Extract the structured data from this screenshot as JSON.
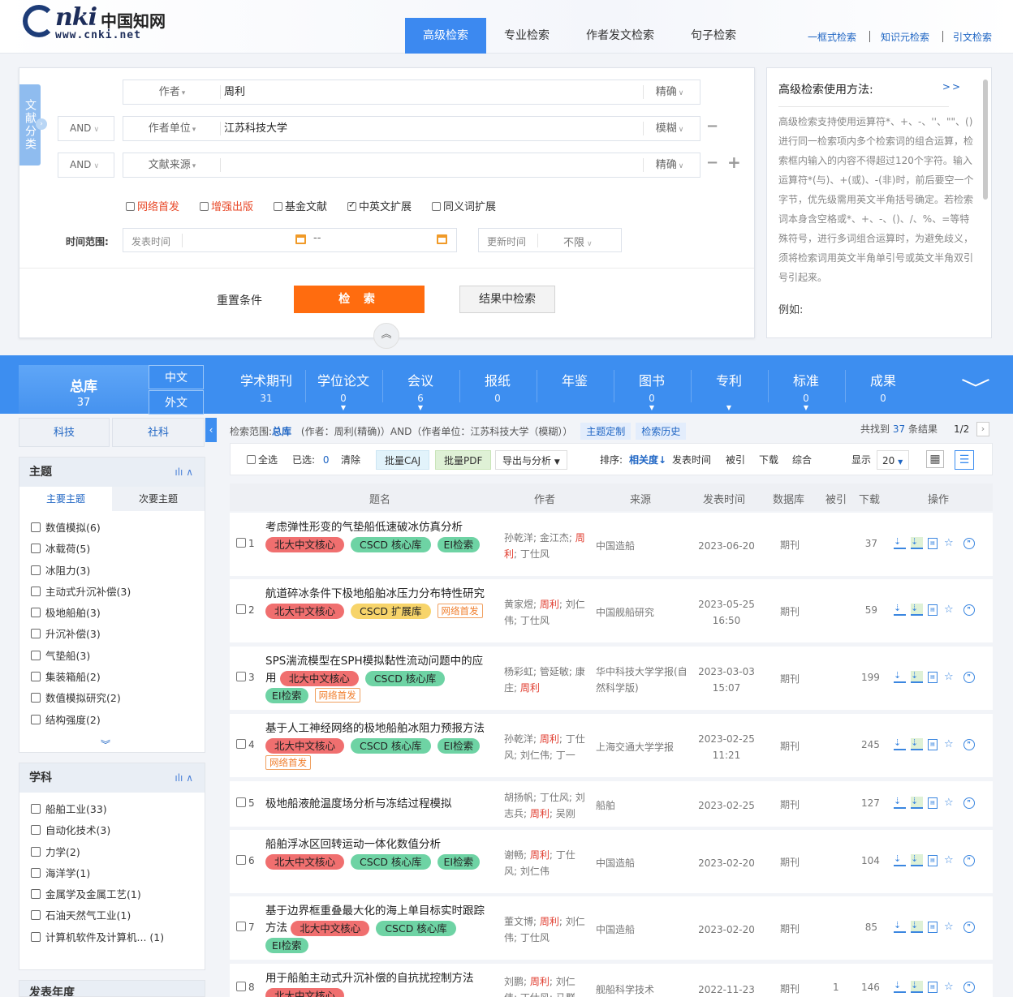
{
  "header": {
    "logo_text": "CNKI",
    "logo_cn": "中国知网",
    "logo_url": "www.cnki.net",
    "tabs": [
      "高级检索",
      "专业检索",
      "作者发文检索",
      "句子检索"
    ],
    "active_tab": "高级检索",
    "links": [
      "一框式检索",
      "知识元检索",
      "引文检索"
    ]
  },
  "search": {
    "category_label": "文献分类",
    "rows": [
      {
        "logic": "",
        "field": "作者",
        "value": "周利",
        "match": "精确"
      },
      {
        "logic": "AND",
        "field": "作者单位",
        "value": "江苏科技大学",
        "match": "模糊"
      },
      {
        "logic": "AND",
        "field": "文献来源",
        "value": "",
        "match": "精确"
      }
    ],
    "options": [
      {
        "label": "网络首发",
        "checked": false,
        "red": true
      },
      {
        "label": "增强出版",
        "checked": false,
        "red": true
      },
      {
        "label": "基金文献",
        "checked": false,
        "red": false
      },
      {
        "label": "中英文扩展",
        "checked": true,
        "red": false
      },
      {
        "label": "同义词扩展",
        "checked": false,
        "red": false
      }
    ],
    "time_label": "时间范围:",
    "publish_time_label": "发表时间",
    "dash": "--",
    "update_time_label": "更新时间",
    "update_time_value": "不限",
    "reset": "重置条件",
    "submit": "检 索",
    "search_in_results": "结果中检索"
  },
  "help": {
    "title": "高级检索使用方法:",
    "more": ">>",
    "text": "高级检索支持使用运算符*、+、-、''、\"\"、()进行同一检索项内多个检索词的组合运算，检索框内输入的内容不得超过120个字符。输入运算符*(与)、+(或)、-(非)时，前后要空一个字节，优先级需用英文半角括号确定。若检索词本身含空格或*、+、-、()、/、%、=等特殊符号，进行多词组合运算时，为避免歧义，须将检索词用英文半角单引号或英文半角双引号引起来。",
    "example_label": "例如:"
  },
  "db_bar": {
    "total": {
      "label": "总库",
      "count": "37"
    },
    "lang": [
      "中文",
      "外文"
    ],
    "categories": [
      {
        "label": "学术期刊",
        "count": "31"
      },
      {
        "label": "学位论文",
        "count": "0"
      },
      {
        "label": "会议",
        "count": "6"
      },
      {
        "label": "报纸",
        "count": "0"
      },
      {
        "label": "年鉴",
        "count": ""
      },
      {
        "label": "图书",
        "count": "0"
      },
      {
        "label": "专利",
        "count": ""
      },
      {
        "label": "标准",
        "count": "0"
      },
      {
        "label": "成果",
        "count": "0"
      }
    ]
  },
  "left": {
    "tabs": [
      "科技",
      "社科"
    ],
    "topic": {
      "title": "主题",
      "subtabs": [
        "主要主题",
        "次要主题"
      ],
      "items": [
        "数值模拟(6)",
        "冰载荷(5)",
        "冰阻力(3)",
        "主动式升沉补偿(3)",
        "极地船舶(3)",
        "升沉补偿(3)",
        "气垫船(3)",
        "集装箱船(2)",
        "数值模拟研究(2)",
        "结构强度(2)"
      ]
    },
    "subject": {
      "title": "学科",
      "items": [
        "船舶工业(33)",
        "自动化技术(3)",
        "力学(2)",
        "海洋学(1)",
        "金属学及金属工艺(1)",
        "石油天然气工业(1)",
        "计算机软件及计算机...  (1)"
      ]
    },
    "next_section": "发表年度"
  },
  "results": {
    "scope_prefix": "检索范围:",
    "scope_db": "总库",
    "scope_query": "(作者：周利(精确)）AND（作者单位：江苏科技大学（模糊））",
    "topic_custom": "主题定制",
    "history": "检索历史",
    "found_prefix": "共找到",
    "found_count": "37",
    "found_suffix": "条结果",
    "page": "1/2",
    "toolbar": {
      "select_all": "全选",
      "selected_label": "已选:",
      "selected_count": "0",
      "clear": "清除",
      "batch_caj": "批量CAJ",
      "batch_pdf": "批量PDF",
      "export": "导出与分析",
      "sort_label": "排序:",
      "sorts": [
        "相关度",
        "发表时间",
        "被引",
        "下载",
        "综合"
      ],
      "display_label": "显示",
      "page_size": "20"
    },
    "headers": [
      "题名",
      "作者",
      "来源",
      "发表时间",
      "数据库",
      "被引",
      "下载",
      "操作"
    ],
    "rows": [
      {
        "n": "1",
        "title": "考虑弹性形变的气垫船低速破冰仿真分析",
        "tags": [
          "北大中文核心",
          "CSCD 核心库",
          "EI检索"
        ],
        "authors": [
          "孙乾洋",
          "金江杰",
          "周利",
          "丁仕风"
        ],
        "source": "中国造船",
        "date": "2023-06-20",
        "time": "",
        "db": "期刊",
        "cited": "",
        "dl": "37"
      },
      {
        "n": "2",
        "title": "航道碎冰条件下极地船舶冰压力分布特性研究",
        "tags": [
          "北大中文核心",
          "CSCD 扩展库",
          "网络首发"
        ],
        "authors": [
          "黄家煜",
          "周利",
          "刘仁伟",
          "丁仕风"
        ],
        "source": "中国舰船研究",
        "date": "2023-05-25",
        "time": "16:50",
        "db": "期刊",
        "cited": "",
        "dl": "59"
      },
      {
        "n": "3",
        "title": "SPS湍流模型在SPH模拟黏性流动问题中的应用",
        "tags": [
          "北大中文核心",
          "CSCD 核心库",
          "EI检索",
          "网络首发"
        ],
        "authors": [
          "杨彩虹",
          "管延敏",
          "康庄",
          "周利"
        ],
        "source": "华中科技大学学报(自然科学版)",
        "date": "2023-03-03",
        "time": "15:07",
        "db": "期刊",
        "cited": "",
        "dl": "199"
      },
      {
        "n": "4",
        "title": "基于人工神经网络的极地船舶冰阻力预报方法",
        "tags": [
          "北大中文核心",
          "CSCD 核心库",
          "EI检索",
          "网络首发"
        ],
        "authors": [
          "孙乾洋",
          "周利",
          "丁仕风",
          "刘仁伟",
          "丁一"
        ],
        "source": "上海交通大学学报",
        "date": "2023-02-25",
        "time": "11:21",
        "db": "期刊",
        "cited": "",
        "dl": "245"
      },
      {
        "n": "5",
        "title": "极地船液舱温度场分析与冻结过程模拟",
        "tags": [],
        "authors": [
          "胡扬帆",
          "丁仕风",
          "刘志兵",
          "周利",
          "吴刚"
        ],
        "source": "船舶",
        "date": "2023-02-25",
        "time": "",
        "db": "期刊",
        "cited": "",
        "dl": "127"
      },
      {
        "n": "6",
        "title": "船舶浮冰区回转运动一体化数值分析",
        "tags": [
          "北大中文核心",
          "CSCD 核心库",
          "EI检索"
        ],
        "authors": [
          "谢畅",
          "周利",
          "丁仕风",
          "刘仁伟"
        ],
        "source": "中国造船",
        "date": "2023-02-20",
        "time": "",
        "db": "期刊",
        "cited": "",
        "dl": "104"
      },
      {
        "n": "7",
        "title": "基于边界框重叠最大化的海上单目标实时跟踪方法",
        "tags": [
          "北大中文核心",
          "CSCD 核心库",
          "EI检索"
        ],
        "authors": [
          "董文博",
          "周利",
          "刘仁伟",
          "丁仕风"
        ],
        "source": "中国造船",
        "date": "2023-02-20",
        "time": "",
        "db": "期刊",
        "cited": "",
        "dl": "85"
      },
      {
        "n": "8",
        "title": "用于船舶主动式升沉补偿的自抗扰控制方法",
        "tags": [
          "北大中文核心"
        ],
        "authors": [
          "刘鹏",
          "周利",
          "刘仁伟",
          "丁仕风",
          "马群"
        ],
        "source": "舰船科学技术",
        "date": "2022-11-23",
        "time": "",
        "db": "期刊",
        "cited": "1",
        "dl": "146"
      }
    ]
  }
}
